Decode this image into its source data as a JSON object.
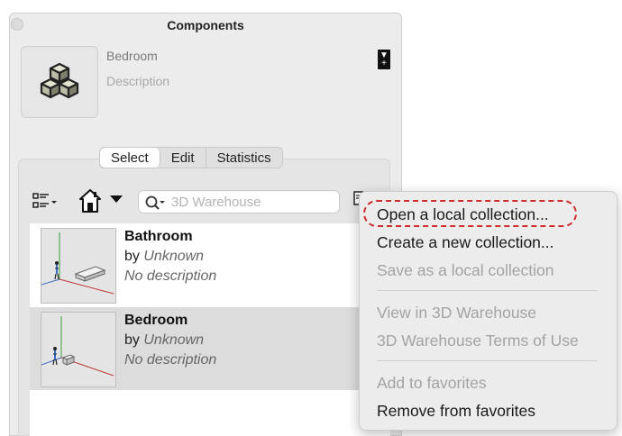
{
  "window": {
    "title": "Components"
  },
  "component": {
    "name": "Bedroom",
    "description": "Description"
  },
  "tabs": [
    {
      "label": "Select"
    },
    {
      "label": "Edit"
    },
    {
      "label": "Statistics"
    }
  ],
  "search": {
    "placeholder": "3D Warehouse"
  },
  "list": [
    {
      "name": "Bathroom",
      "by": "by",
      "author": "Unknown",
      "description": "No description"
    },
    {
      "name": "Bedroom",
      "by": "by",
      "author": "Unknown",
      "description": "No description"
    }
  ],
  "menu": {
    "items": [
      {
        "label": "Open a local collection...",
        "enabled": true
      },
      {
        "label": "Create a new collection...",
        "enabled": true
      },
      {
        "label": "Save as a local collection",
        "enabled": false
      },
      {
        "label": "View in 3D Warehouse",
        "enabled": false
      },
      {
        "label": "3D Warehouse Terms of Use",
        "enabled": false
      },
      {
        "label": "Add to favorites",
        "enabled": false
      },
      {
        "label": "Remove from favorites",
        "enabled": true
      }
    ]
  },
  "colors": {
    "highlight": "#cc2e2e",
    "disabled_text": "#a3a3a3"
  }
}
